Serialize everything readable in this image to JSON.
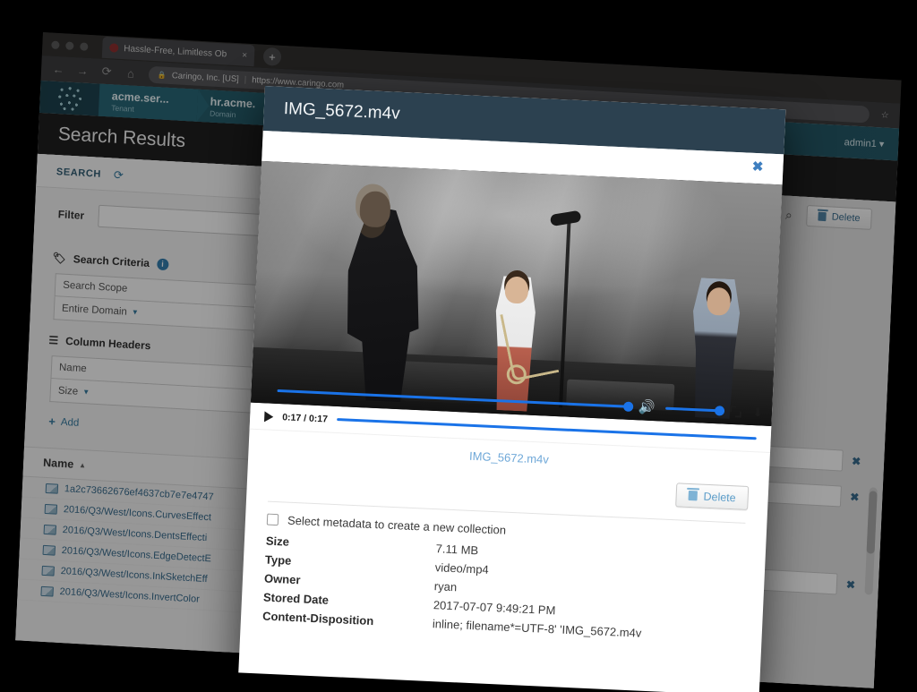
{
  "browser": {
    "tab": {
      "title": "Hassle-Free, Limitless Ob",
      "close": "×",
      "favicon_name": "site-favicon"
    },
    "new_tab": "+",
    "nav": {
      "back": "←",
      "forward": "→",
      "reload": "⟳",
      "home": "⌂"
    },
    "url": {
      "lock": "🔒",
      "site_identity": "Caringo, Inc. [US]",
      "divider": "|",
      "address": "https://www.caringo.com",
      "bookmark": "☆"
    }
  },
  "app": {
    "breadcrumbs": [
      {
        "name": "acme.ser...",
        "type": "Tenant"
      },
      {
        "name": "hr.acme.",
        "type": "Domain"
      }
    ],
    "user_menu": "admin1 ▾",
    "page_title": "Search Results",
    "left_panel": {
      "tab_label": "SEARCH",
      "refresh_icon": "⟳",
      "filter_label": "Filter",
      "filter_value": "",
      "search_criteria_label": "Search Criteria",
      "info_icon": "i",
      "search_scope_label": "Search Scope",
      "scope_value": "Entire Domain",
      "column_headers_label": "Column Headers",
      "column_name": "Name",
      "column_size": "Size",
      "add_label": "Add",
      "list_header": "Name",
      "sort_arrow": "▲",
      "files": [
        "1a2c73662676ef4637cb7e7e4747",
        "2016/Q3/West/Icons.CurvesEffect",
        "2016/Q3/West/Icons.DentsEffecti",
        "2016/Q3/West/Icons.EdgeDetectE",
        "2016/Q3/West/Icons.InkSketchEff",
        "2016/Q3/West/Icons.InvertColor"
      ]
    },
    "right_panel": {
      "search_icon": "⌕",
      "delete_label": "Delete",
      "remove_icon": "✖"
    }
  },
  "modal": {
    "title": "IMG_5672.m4v",
    "close_icon": "✖",
    "video": {
      "play_icon": "play-triangle",
      "current_time": "0:17",
      "separator": "/",
      "duration": "0:17",
      "time_display": "0:17 / 0:17",
      "volume_icon": "🔊",
      "fullscreen_icon": "fullscreen",
      "download_icon": "⬇",
      "progress_percent": 100,
      "volume_percent": 100
    },
    "file_link": "IMG_5672.m4v",
    "delete_label": "Delete",
    "metadata_checkbox_label": "Select metadata to create a new collection",
    "metadata_checked": false,
    "metadata": [
      {
        "key": "Size",
        "value": "7.11 MB"
      },
      {
        "key": "Type",
        "value": "video/mp4"
      },
      {
        "key": "Owner",
        "value": "ryan"
      },
      {
        "key": "Stored Date",
        "value": "2017-07-07 9:49:21 PM"
      },
      {
        "key": "Content-Disposition",
        "value": "inline; filename*=UTF-8' 'IMG_5672.m4v"
      }
    ]
  },
  "colors": {
    "modal_header": "#2c4150",
    "accent_blue": "#1a73e8",
    "link_blue": "#6fa8d8",
    "teal_bar": "#1d5a6b",
    "page_bg": "#000000"
  }
}
